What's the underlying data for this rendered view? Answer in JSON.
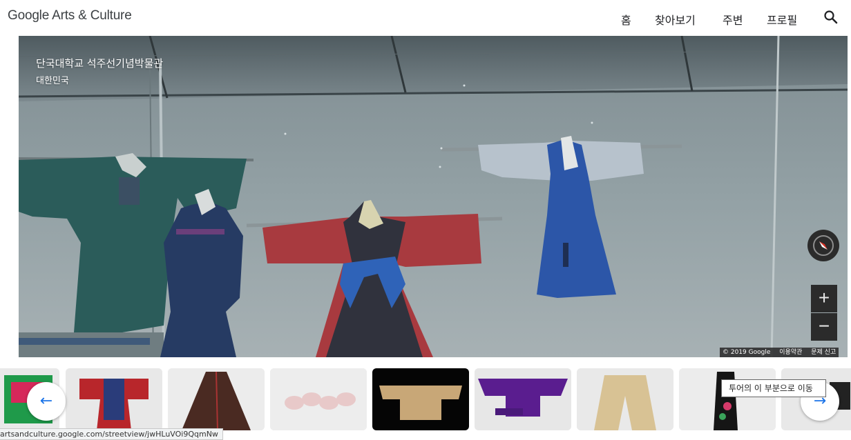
{
  "header": {
    "logo": "Google Arts & Culture",
    "nav": [
      "홈",
      "찾아보기",
      "주변",
      "프로필"
    ]
  },
  "viewer": {
    "title": "단국대학교 석주선기념박물관",
    "subtitle": "대한민국",
    "zoom_in": "+",
    "zoom_out": "−",
    "attribution": [
      "© 2019 Google",
      "이용약관",
      "문제 신고"
    ]
  },
  "strip": {
    "prev_arrow": "←",
    "next_arrow": "→",
    "tooltip": "투어의 이 부분으로 이동"
  },
  "statusbar": {
    "url": "artsandculture.google.com/streetview/jwHLuVOi9QqmNw"
  },
  "colors": {
    "accent": "#1a73e8",
    "wall": "#8a979b",
    "control_bg": "#2b2b2b"
  }
}
